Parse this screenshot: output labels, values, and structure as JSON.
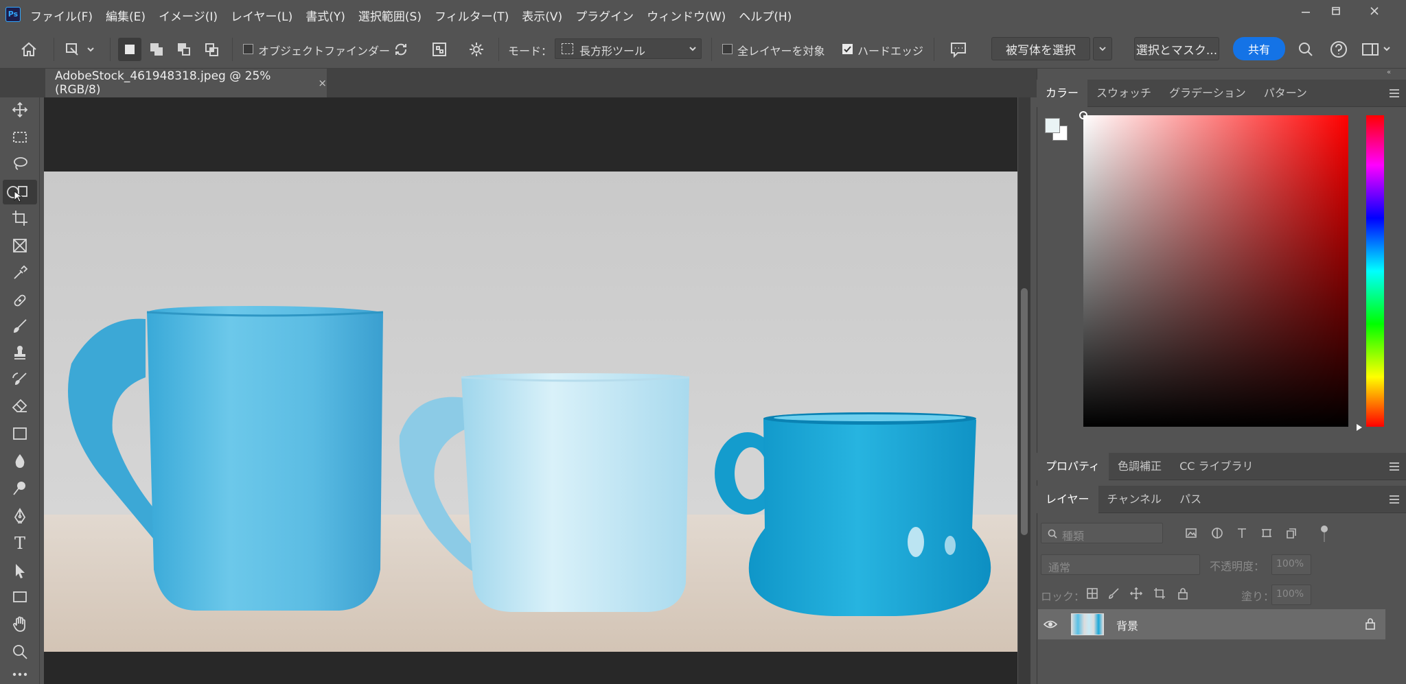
{
  "app": {
    "logo": "Ps"
  },
  "menu": {
    "items": [
      "ファイル(F)",
      "編集(E)",
      "イメージ(I)",
      "レイヤー(L)",
      "書式(Y)",
      "選択範囲(S)",
      "フィルター(T)",
      "表示(V)",
      "プラグイン",
      "ウィンドウ(W)",
      "ヘルプ(H)"
    ]
  },
  "window_controls": {
    "icons": [
      "minimize-icon",
      "restore-icon",
      "close-icon"
    ]
  },
  "options_bar": {
    "object_finder_label": "オブジェクトファインダー",
    "object_finder_checked": false,
    "mode_label": "モード：",
    "mode_value": "長方形ツール",
    "all_layers_label": "全レイヤーを対象",
    "all_layers_checked": false,
    "hard_edge_label": "ハードエッジ",
    "hard_edge_checked": true,
    "select_subject_label": "被写体を選択",
    "select_mask_label": "選択とマスク...",
    "share_label": "共有"
  },
  "document": {
    "tab_title": "AdobeStock_461948318.jpeg @ 25% (RGB/8)",
    "close_glyph": "×"
  },
  "tools": [
    "move-tool",
    "marquee-tool",
    "lasso-tool",
    "object-selection-tool",
    "crop-tool",
    "frame-tool",
    "eyedropper-tool",
    "spot-healing-tool",
    "brush-tool",
    "clone-stamp-tool",
    "history-brush-tool",
    "eraser-tool",
    "gradient-tool",
    "blur-tool",
    "dodge-tool",
    "pen-tool",
    "type-tool",
    "path-selection-tool",
    "rectangle-tool",
    "hand-tool",
    "zoom-tool",
    "more-tools"
  ],
  "type_tool_glyph": "T",
  "color_panel": {
    "tabs": [
      "カラー",
      "スウォッチ",
      "グラデーション",
      "パターン"
    ],
    "active_tab": "カラー",
    "foreground": "#eaf4f5",
    "background": "#ffffff",
    "hue": "#ff0000"
  },
  "properties_panel": {
    "tabs": [
      "プロパティ",
      "色調補正",
      "CC ライブラリ"
    ],
    "active_tab": "プロパティ"
  },
  "layers_panel": {
    "tabs": [
      "レイヤー",
      "チャンネル",
      "パス"
    ],
    "active_tab": "レイヤー",
    "filter_placeholder": "種類",
    "blend_mode": "通常",
    "opacity_label": "不透明度：",
    "opacity_value": "100%",
    "lock_label": "ロック：",
    "fill_label": "塗り：",
    "fill_value": "100%",
    "layers": [
      {
        "name": "背景",
        "visible": true,
        "locked": true
      }
    ]
  }
}
